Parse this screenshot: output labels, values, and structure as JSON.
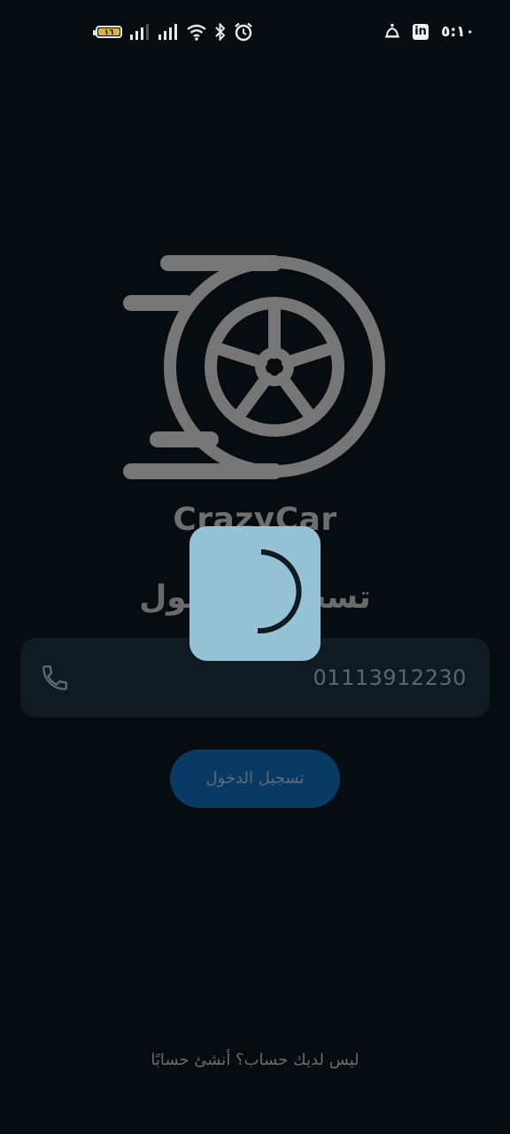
{
  "status_bar": {
    "time": "٥:١٠",
    "battery_level": "١٦",
    "icons": [
      "battery-icon",
      "signal-icon",
      "signal-icon",
      "wifi-icon",
      "bluetooth-icon",
      "alarm-icon",
      "notification-bell-icon",
      "linkedin-icon"
    ]
  },
  "app": {
    "brand_name": "CrazyCar",
    "heading": "تسجيل الدخول"
  },
  "phone_field": {
    "value": "01113912230",
    "icon": "phone-icon"
  },
  "login_button": {
    "label": "تسجيل الدخول"
  },
  "footer": {
    "signup_text": "ليس لديك حساب؟ أنشئ حسابًا"
  },
  "loading": {
    "visible": true
  },
  "colors": {
    "background": "#070c11",
    "field_background": "#101b21",
    "button_background": "#083a63",
    "dialog_background": "#95c2d5",
    "logo_gray": "#767676"
  }
}
